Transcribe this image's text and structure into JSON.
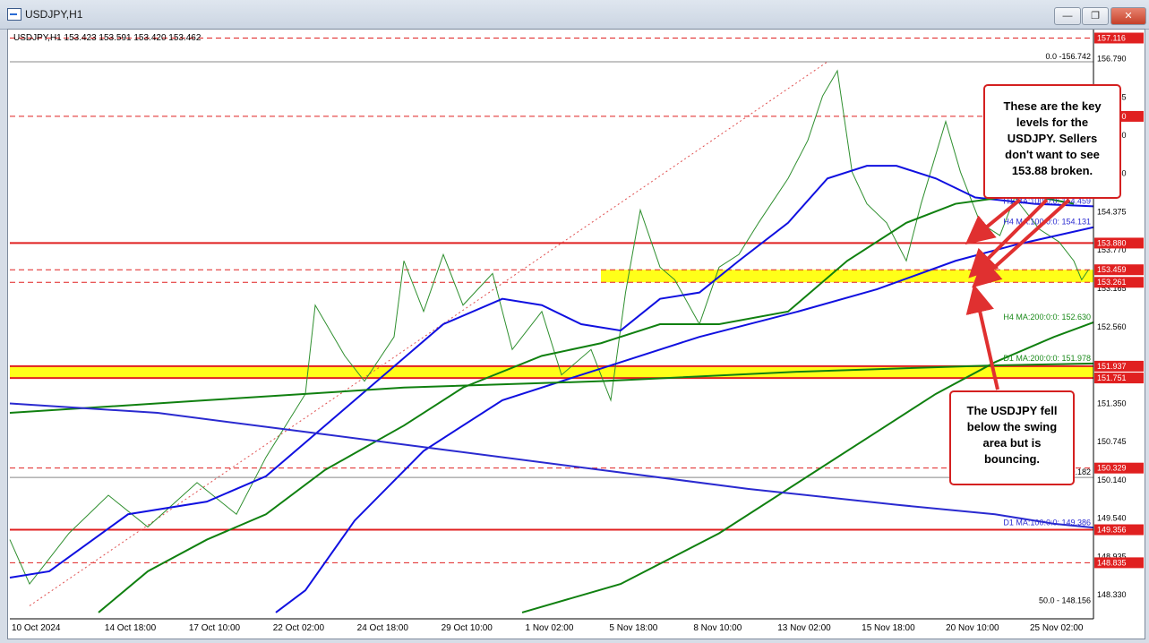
{
  "window": {
    "title": "USDJPY,H1",
    "minimize_label": "—",
    "restore_label": "❐",
    "close_label": "✕"
  },
  "chart_data": {
    "type": "line",
    "symbol_info": "USDJPY,H1  153.423 153.591 153.420 153.462",
    "x_tick_labels": [
      "10 Oct 2024",
      "14 Oct 18:00",
      "17 Oct 10:00",
      "22 Oct 02:00",
      "24 Oct 18:00",
      "29 Oct 10:00",
      "1 Nov 02:00",
      "5 Nov 18:00",
      "8 Nov 10:00",
      "13 Nov 02:00",
      "15 Nov 18:00",
      "20 Nov 10:00",
      "25 Nov 02:00"
    ],
    "y_tick_labels": [
      156.79,
      156.185,
      155.58,
      154.98,
      154.375,
      153.77,
      153.165,
      152.56,
      151.35,
      150.745,
      150.14,
      149.54,
      148.935,
      148.33
    ],
    "ylim": [
      147.95,
      157.25
    ],
    "horizontal_levels": [
      {
        "label": "157.116",
        "value": 157.116,
        "color": "#e02020",
        "style": "dashed"
      },
      {
        "label": "155.880",
        "value": 155.88,
        "color": "#e02020",
        "style": "dashed"
      },
      {
        "label": "153.880",
        "value": 153.88,
        "color": "#e02020",
        "style": "solid"
      },
      {
        "label": "153.459",
        "value": 153.459,
        "color": "#e02020",
        "style": "dashed"
      },
      {
        "label": "153.261",
        "value": 153.261,
        "color": "#e02020",
        "style": "dashed"
      },
      {
        "label": "151.937",
        "value": 151.937,
        "color": "#e02020",
        "style": "solid"
      },
      {
        "label": "151.751",
        "value": 151.751,
        "color": "#e02020",
        "style": "solid"
      },
      {
        "label": "150.329",
        "value": 150.329,
        "color": "#e02020",
        "style": "dashed"
      },
      {
        "label": "149.356",
        "value": 149.356,
        "color": "#e02020",
        "style": "solid"
      },
      {
        "label": "148.835",
        "value": 148.835,
        "color": "#e02020",
        "style": "dashed"
      }
    ],
    "swing_zones": [
      {
        "from": 153.261,
        "to": 153.459,
        "color": "#ffff00"
      },
      {
        "from": 151.751,
        "to": 151.937,
        "color": "#ffff00"
      }
    ],
    "fib_labels": [
      {
        "text": "0.0 -156.742",
        "value": 156.742
      },
      {
        "text": "50.0 - 148.156",
        "value": 148.156
      },
      {
        "text": "0.182",
        "value": 150.182
      }
    ],
    "ma_labels": [
      {
        "text": "H1 MA:100:0:0: 154.459",
        "value": 154.459,
        "color": "#2a2ad0"
      },
      {
        "text": "H4 MA:100:0:0: 154.131",
        "value": 154.131,
        "color": "#2a2ad0"
      },
      {
        "text": "H4 MA:200:0:0: 152.630",
        "value": 152.63,
        "color": "#1a8a1a"
      },
      {
        "text": "D1 MA:200:0:0: 151.978",
        "value": 151.978,
        "color": "#1a8a1a"
      },
      {
        "text": "D1 MA:100:0:0: 149.386",
        "value": 149.386,
        "color": "#2a2ad0"
      }
    ],
    "series": [
      {
        "name": "price",
        "color": "#2f8f2f",
        "points": [
          [
            0,
            149.2
          ],
          [
            20,
            148.5
          ],
          [
            60,
            149.3
          ],
          [
            100,
            149.9
          ],
          [
            140,
            149.4
          ],
          [
            190,
            150.1
          ],
          [
            230,
            149.6
          ],
          [
            260,
            150.5
          ],
          [
            300,
            151.5
          ],
          [
            310,
            152.9
          ],
          [
            340,
            152.1
          ],
          [
            360,
            151.7
          ],
          [
            390,
            152.4
          ],
          [
            400,
            153.6
          ],
          [
            420,
            152.8
          ],
          [
            440,
            153.7
          ],
          [
            460,
            152.9
          ],
          [
            490,
            153.4
          ],
          [
            510,
            152.2
          ],
          [
            540,
            152.8
          ],
          [
            560,
            151.8
          ],
          [
            590,
            152.2
          ],
          [
            610,
            151.4
          ],
          [
            625,
            153.1
          ],
          [
            640,
            154.4
          ],
          [
            660,
            153.5
          ],
          [
            675,
            153.3
          ],
          [
            700,
            152.6
          ],
          [
            720,
            153.5
          ],
          [
            740,
            153.7
          ],
          [
            760,
            154.2
          ],
          [
            790,
            154.9
          ],
          [
            810,
            155.5
          ],
          [
            825,
            156.2
          ],
          [
            840,
            156.6
          ],
          [
            855,
            155.0
          ],
          [
            870,
            154.5
          ],
          [
            890,
            154.2
          ],
          [
            910,
            153.6
          ],
          [
            925,
            154.5
          ],
          [
            950,
            155.8
          ],
          [
            965,
            155.0
          ],
          [
            985,
            154.2
          ],
          [
            1005,
            154.0
          ],
          [
            1020,
            154.6
          ],
          [
            1045,
            154.1
          ],
          [
            1065,
            153.9
          ],
          [
            1080,
            153.6
          ],
          [
            1088,
            153.3
          ],
          [
            1095,
            153.46
          ]
        ]
      },
      {
        "name": "H1 MA 100",
        "color": "#1010e0",
        "points": [
          [
            0,
            148.6
          ],
          [
            40,
            148.7
          ],
          [
            120,
            149.6
          ],
          [
            200,
            149.8
          ],
          [
            260,
            150.2
          ],
          [
            320,
            151.0
          ],
          [
            380,
            151.8
          ],
          [
            440,
            152.6
          ],
          [
            500,
            153.0
          ],
          [
            540,
            152.9
          ],
          [
            580,
            152.6
          ],
          [
            620,
            152.5
          ],
          [
            660,
            153.0
          ],
          [
            700,
            153.1
          ],
          [
            740,
            153.6
          ],
          [
            790,
            154.2
          ],
          [
            830,
            154.9
          ],
          [
            870,
            155.1
          ],
          [
            900,
            155.1
          ],
          [
            940,
            154.9
          ],
          [
            980,
            154.6
          ],
          [
            1040,
            154.5
          ],
          [
            1100,
            154.46
          ]
        ]
      },
      {
        "name": "H4 MA 100",
        "color": "#1010e0",
        "points": [
          [
            270,
            148.05
          ],
          [
            300,
            148.4
          ],
          [
            350,
            149.5
          ],
          [
            420,
            150.6
          ],
          [
            500,
            151.4
          ],
          [
            600,
            151.9
          ],
          [
            700,
            152.4
          ],
          [
            800,
            152.8
          ],
          [
            880,
            153.15
          ],
          [
            960,
            153.6
          ],
          [
            1020,
            153.85
          ],
          [
            1100,
            154.13
          ]
        ]
      },
      {
        "name": "H1 MA 200",
        "color": "#108010",
        "points": [
          [
            90,
            148.05
          ],
          [
            140,
            148.7
          ],
          [
            200,
            149.2
          ],
          [
            260,
            149.6
          ],
          [
            320,
            150.3
          ],
          [
            400,
            151.0
          ],
          [
            460,
            151.6
          ],
          [
            540,
            152.1
          ],
          [
            600,
            152.3
          ],
          [
            660,
            152.6
          ],
          [
            720,
            152.6
          ],
          [
            790,
            152.8
          ],
          [
            850,
            153.6
          ],
          [
            910,
            154.2
          ],
          [
            960,
            154.5
          ],
          [
            1030,
            154.65
          ],
          [
            1080,
            154.5
          ]
        ]
      },
      {
        "name": "H4 MA 200",
        "color": "#108010",
        "points": [
          [
            520,
            148.05
          ],
          [
            620,
            148.5
          ],
          [
            720,
            149.3
          ],
          [
            820,
            150.3
          ],
          [
            880,
            150.9
          ],
          [
            940,
            151.5
          ],
          [
            1000,
            152.0
          ],
          [
            1060,
            152.4
          ],
          [
            1100,
            152.63
          ]
        ]
      },
      {
        "name": "D1 MA 200",
        "color": "#108010",
        "points": [
          [
            0,
            151.2
          ],
          [
            200,
            151.4
          ],
          [
            400,
            151.6
          ],
          [
            600,
            151.7
          ],
          [
            800,
            151.85
          ],
          [
            1000,
            151.95
          ],
          [
            1100,
            151.98
          ]
        ]
      },
      {
        "name": "D1 MA 100",
        "color": "#2a2ad0",
        "points": [
          [
            0,
            151.35
          ],
          [
            150,
            151.2
          ],
          [
            300,
            150.9
          ],
          [
            450,
            150.6
          ],
          [
            600,
            150.3
          ],
          [
            750,
            150.0
          ],
          [
            900,
            149.75
          ],
          [
            1000,
            149.6
          ],
          [
            1060,
            149.45
          ],
          [
            1100,
            149.39
          ]
        ]
      }
    ],
    "annotations": [
      {
        "text": "These are the key levels for the USDJPY.  Sellers don't want to see 153.88 broken.",
        "position": "top-right"
      },
      {
        "text": "The USDJPY fell below the swing area but is bouncing.",
        "position": "bottom-right"
      }
    ]
  }
}
